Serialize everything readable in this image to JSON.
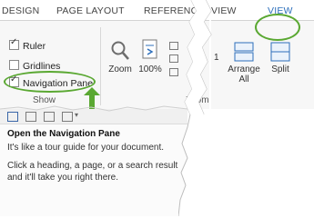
{
  "ribbon": {
    "tabs": {
      "design": "DESIGN",
      "page_layout": "PAGE LAYOUT",
      "references": "REFERENCES",
      "view_partial": "VIEW",
      "view": "VIEW"
    },
    "show_group": {
      "label": "Show",
      "ruler": {
        "label": "Ruler",
        "checked": true
      },
      "gridlines": {
        "label": "Gridlines",
        "checked": false
      },
      "navigation_pane": {
        "label": "Navigation Pane",
        "checked": true
      }
    },
    "zoom_group": {
      "label": "Zoom",
      "zoom_btn": "Zoom",
      "percent_btn": "100%"
    },
    "window_group": {
      "arrange_all_1": "Arrange",
      "arrange_all_2": "All",
      "split": "Split"
    },
    "partial_text": "1"
  },
  "tooltip": {
    "title": "Open the Navigation Pane",
    "line1": "It's like a tour guide for your document.",
    "line2": "Click a heading, a page, or a search result and it'll take you right there."
  },
  "colors": {
    "accent_green": "#5aa832",
    "word_blue": "#2d6fbb"
  }
}
